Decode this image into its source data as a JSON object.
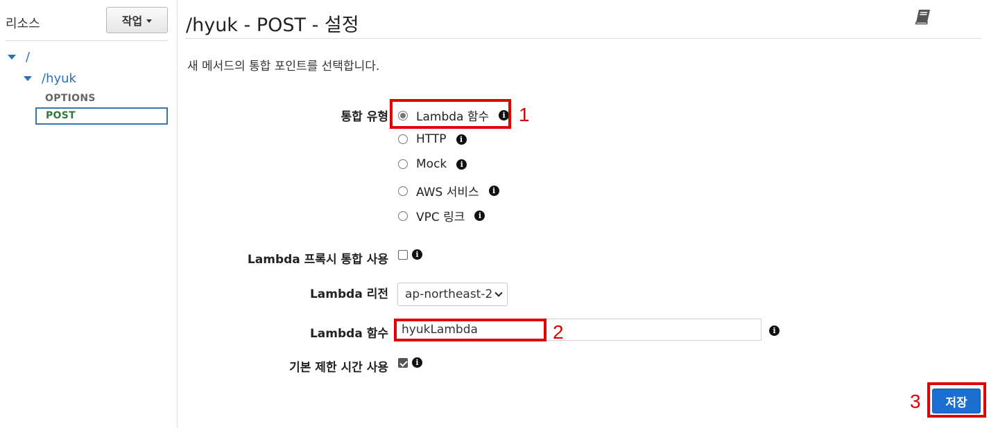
{
  "sidebar": {
    "title": "리소스",
    "action_button": "작업",
    "tree": [
      {
        "label": "/"
      },
      {
        "label": "/hyuk"
      }
    ],
    "methods": [
      "OPTIONS",
      "POST"
    ],
    "selected_method": "POST"
  },
  "main": {
    "title": "/hyuk - POST - 설정",
    "description": "새 메서드의 통합 포인트를 선택합니다.",
    "integration_type": {
      "label": "통합 유형",
      "options": [
        "Lambda 함수",
        "HTTP",
        "Mock",
        "AWS 서비스",
        "VPC 링크"
      ],
      "selected": "Lambda 함수"
    },
    "proxy": {
      "label": "Lambda 프록시 통합 사용",
      "checked": false
    },
    "region": {
      "label": "Lambda 리전",
      "value": "ap-northeast-2"
    },
    "function": {
      "label": "Lambda 함수",
      "value": "hyukLambda"
    },
    "timeout": {
      "label": "기본 제한 시간 사용",
      "checked": true
    },
    "save_label": "저장"
  },
  "annotations": [
    "1",
    "2",
    "3"
  ],
  "colors": {
    "accent_blue": "#1a6fd0",
    "highlight_red": "#e00000",
    "link_blue": "#2c6fb4",
    "active_green": "#2f7a3a"
  },
  "icons": [
    "book-icon",
    "info-icon",
    "caret-down-icon",
    "tree-expand-icon"
  ]
}
